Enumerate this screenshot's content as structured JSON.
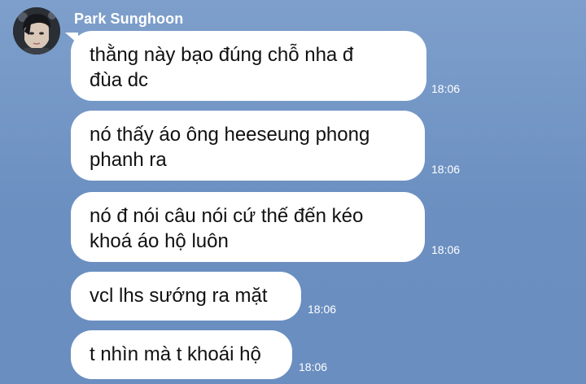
{
  "chat": {
    "sender_name": "Park Sunghoon",
    "messages": [
      {
        "text": "thằng này bạo đúng chỗ nha đ đùa dc",
        "line1": "thằng này bạo đúng chỗ nha đ",
        "line2": "đùa dc",
        "time": "18:06"
      },
      {
        "text": "nó thấy áo ông heeseung phong phanh ra",
        "line1": "nó thấy áo ông heeseung phong",
        "line2": "phanh ra",
        "time": "18:06"
      },
      {
        "text": "nó đ nói câu nói cứ thế đến kéo khoá áo hộ luôn",
        "line1": "nó đ nói câu nói cứ thế đến kéo",
        "line2": "khoá áo hộ luôn",
        "time": "18:06"
      },
      {
        "text": "vcl lhs sướng ra mặt",
        "line1": "vcl lhs sướng ra mặt",
        "time": "18:06"
      },
      {
        "text": "t nhìn mà t khoái hộ",
        "line1": "t nhìn mà t khoái hộ",
        "time": "18:06"
      }
    ]
  }
}
